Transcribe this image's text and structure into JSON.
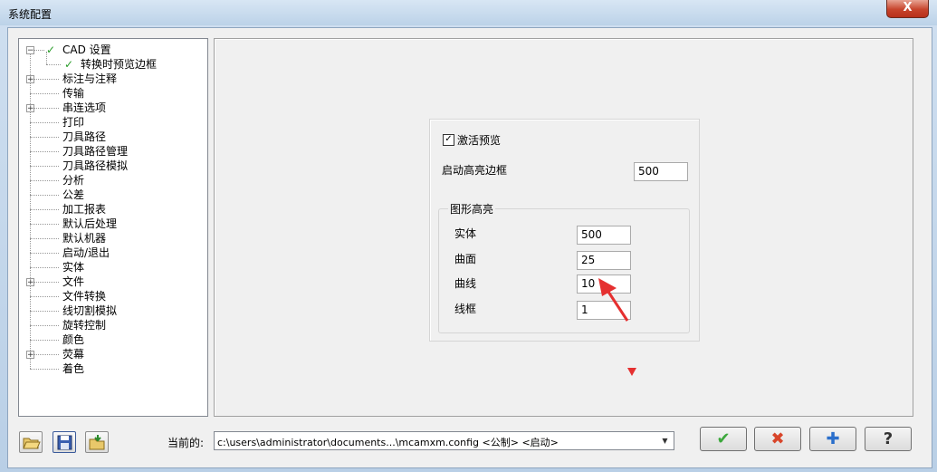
{
  "window": {
    "title": "系统配置",
    "close_glyph": "X"
  },
  "tree": {
    "items": [
      {
        "label": "CAD 设置",
        "expander": "−",
        "checked": true
      },
      {
        "label": "转换时预览边框",
        "checked": true
      },
      {
        "label": "标注与注释",
        "expander": "+"
      },
      {
        "label": "传输"
      },
      {
        "label": "串连选项",
        "expander": "+"
      },
      {
        "label": "打印"
      },
      {
        "label": "刀具路径"
      },
      {
        "label": "刀具路径管理"
      },
      {
        "label": "刀具路径模拟"
      },
      {
        "label": "分析"
      },
      {
        "label": "公差"
      },
      {
        "label": "加工报表"
      },
      {
        "label": "默认后处理"
      },
      {
        "label": "默认机器"
      },
      {
        "label": "启动/退出"
      },
      {
        "label": "实体"
      },
      {
        "label": "文件",
        "expander": "+"
      },
      {
        "label": "文件转换"
      },
      {
        "label": "线切割模拟"
      },
      {
        "label": "旋转控制"
      },
      {
        "label": "颜色"
      },
      {
        "label": "荧幕",
        "expander": "+"
      },
      {
        "label": "着色"
      }
    ],
    "check_glyph": "✓"
  },
  "settings": {
    "activate_preview": {
      "label": "激活预览",
      "checked": true,
      "glyph": "✓"
    },
    "startup_highlight_border": {
      "label": "启动高亮边框",
      "value": "500"
    },
    "graphics_highlight": {
      "title": "图形高亮",
      "solid": {
        "label": "实体",
        "value": "500"
      },
      "surface": {
        "label": "曲面",
        "value": "25"
      },
      "curve": {
        "label": "曲线",
        "value": "10"
      },
      "wireframe": {
        "label": "线框",
        "value": "1"
      }
    }
  },
  "bottom": {
    "current_label": "当前的:",
    "config_path": "c:\\users\\administrator\\documents...\\mcamxm.config <公制> <启动>",
    "combo_arrow": "▼",
    "ok_glyph": "✔",
    "cancel_glyph": "✖",
    "apply_glyph": "✚",
    "help_glyph": "?"
  },
  "colors": {
    "annotation_red": "#e53030",
    "ok_green": "#3ca83c",
    "cancel_red": "#d8452a",
    "apply_blue": "#2b6fcb"
  }
}
